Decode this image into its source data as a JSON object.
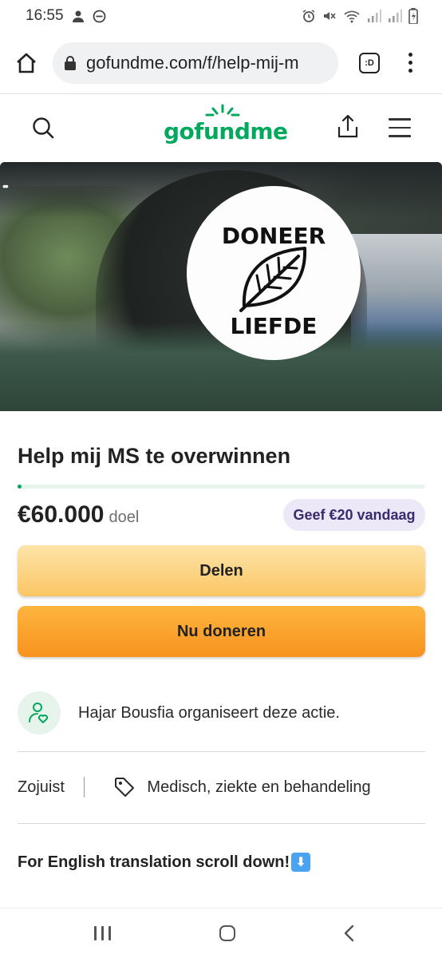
{
  "status_bar": {
    "time": "16:55",
    "left_icons": [
      "person-icon",
      "do-not-disturb-icon"
    ],
    "right_icons": [
      "alarm-icon",
      "mute-icon",
      "wifi-icon",
      "signal-icon",
      "signal-icon",
      "battery-icon"
    ]
  },
  "browser": {
    "url": "gofundme.com/f/help-mij-m",
    "tab_badge": ":D"
  },
  "header": {
    "logo_text": "gofundme",
    "brand_color": "#02a95c"
  },
  "hero": {
    "sticker_top": "DONEER",
    "sticker_bottom": "LIEFDE"
  },
  "campaign": {
    "title": "Help mij MS te overwinnen",
    "progress_fraction": 0.01,
    "goal_amount": "€60.000",
    "goal_label": "doel",
    "suggest_chip": "Geef €20 vandaag",
    "share_label": "Delen",
    "donate_label": "Nu doneren",
    "organizer_text": "Hajar Bousfia organiseert deze actie.",
    "created": "Zojuist",
    "category": "Medisch, ziekte en behandeling",
    "english_note": "For English translation scroll down!",
    "english_arrow": "⬇"
  }
}
